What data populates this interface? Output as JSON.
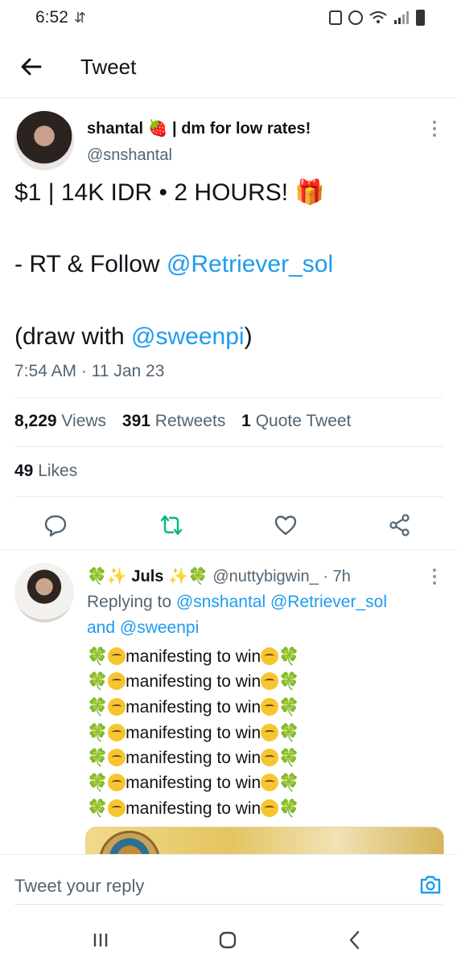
{
  "status_bar": {
    "time": "6:52"
  },
  "header": {
    "title": "Tweet"
  },
  "tweet": {
    "author_name": "shantal 🍓 | dm for low rates!",
    "author_handle": "@snshantal",
    "line1": "$1 | 14K IDR • 2 HOURS! 🎁",
    "line2_prefix": "- RT & Follow ",
    "line2_mention": "@Retriever_sol",
    "line3_prefix": "(draw with ",
    "line3_mention": "@sweenpi",
    "line3_suffix": ")",
    "timestamp": "7:54 AM · 11 Jan 23",
    "stats": {
      "views_count": "8,229",
      "views_label": "Views",
      "retweets_count": "391",
      "retweets_label": "Retweets",
      "quotes_count": "1",
      "quotes_label": "Quote Tweet",
      "likes_count": "49",
      "likes_label": "Likes"
    },
    "action_icons": [
      "reply-icon",
      "retweet-icon",
      "like-icon",
      "share-icon"
    ]
  },
  "reply": {
    "name": "🍀✨ Juls ✨🍀",
    "handle": "@nuttybigwin_",
    "time": "· 7h",
    "replying_label": "Replying to",
    "replying_mention1": "@snshantal",
    "replying_mention2": "@Retriever_sol",
    "replying_and": "and",
    "replying_mention3": "@sweenpi",
    "lines": [
      "manifesting to win",
      "manifesting to win",
      "manifesting to win",
      "manifesting to win",
      "manifesting to win",
      "manifesting to win",
      "manifesting to win"
    ]
  },
  "reply_bar": {
    "placeholder": "Tweet your reply"
  },
  "colors": {
    "link": "#1d9bf0",
    "text": "#0f1419",
    "secondary": "#536471",
    "retweet": "#00ba7c"
  }
}
